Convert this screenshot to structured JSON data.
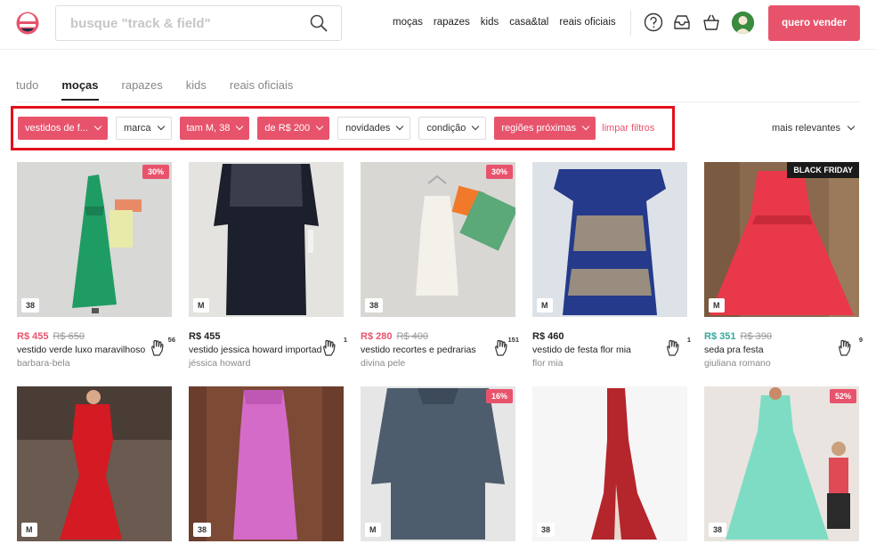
{
  "search": {
    "placeholder": "busque \"track & field\""
  },
  "topnav": [
    "moças",
    "rapazes",
    "kids",
    "casa&tal",
    "reais oficiais"
  ],
  "header": {
    "sell_label": "quero vender"
  },
  "tabs": [
    "tudo",
    "moças",
    "rapazes",
    "kids",
    "reais oficiais"
  ],
  "filters": [
    {
      "label": "vestidos de f...",
      "active": true
    },
    {
      "label": "marca",
      "active": false
    },
    {
      "label": "tam M, 38",
      "active": true
    },
    {
      "label": "de R$ 200",
      "active": true
    },
    {
      "label": "novidades",
      "active": false
    },
    {
      "label": "condição",
      "active": false
    },
    {
      "label": "regiões próximas",
      "active": true
    }
  ],
  "clear_filters": "limpar filtros",
  "sort": "mais relevantes",
  "colors": {
    "accent": "#e8536c",
    "highlight_frame": "#e3101a",
    "teal_price": "#35a79c"
  },
  "products": [
    {
      "size": "38",
      "badge": "30%",
      "price": "R$ 455",
      "old_price": "R$ 650",
      "title": "vestido verde luxo maravilhoso",
      "brand": "barbara-bela",
      "likes": "56"
    },
    {
      "size": "M",
      "badge": "",
      "price": "R$ 455",
      "old_price": "",
      "title": "vestido jessica howard importado",
      "brand": "jéssica howard",
      "likes": "1"
    },
    {
      "size": "38",
      "badge": "30%",
      "price": "R$ 280",
      "old_price": "R$ 400",
      "title": "vestido recortes e pedrarias",
      "brand": "divina pele",
      "likes": "151"
    },
    {
      "size": "M",
      "badge": "",
      "price": "R$ 460",
      "old_price": "",
      "title": "vestido de festa flor mia",
      "brand": "flor mia",
      "likes": "1"
    },
    {
      "size": "M",
      "badge": "BLACK FRIDAY",
      "price": "R$ 351",
      "old_price": "R$ 390",
      "title": "seda pra festa",
      "brand": "giuliana romano",
      "likes": "9"
    },
    {
      "size": "M",
      "badge": ""
    },
    {
      "size": "38",
      "badge": ""
    },
    {
      "size": "M",
      "badge": "16%"
    },
    {
      "size": "38",
      "badge": ""
    },
    {
      "size": "38",
      "badge": "52%"
    }
  ]
}
